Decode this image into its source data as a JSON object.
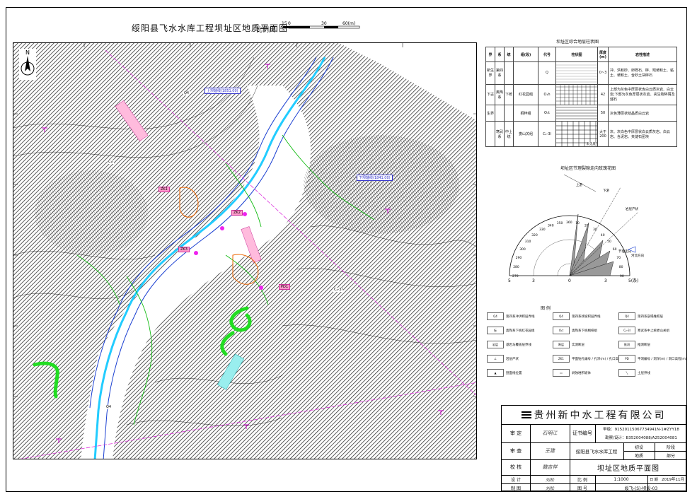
{
  "header": {
    "title": "绥阳县飞水水库工程坝址区地质平面图",
    "scale_label": "比例尺",
    "scale_ticks": [
      "15",
      "0",
      "30",
      "60(m)"
    ]
  },
  "map": {
    "north_label": "N",
    "labels": [
      {
        "text": "上坝轴线(1851.00)",
        "style": "blue"
      },
      {
        "text": "下坝轴线(1841.00)",
        "style": "blue"
      },
      {
        "text": "Q4",
        "style": "dark"
      },
      {
        "text": "C₂l",
        "style": "dark"
      },
      {
        "text": "ZK1",
        "style": "pink"
      },
      {
        "text": "ZK2",
        "style": "pink"
      },
      {
        "text": "ZK3",
        "style": "pink"
      },
      {
        "text": "PD1",
        "style": "pink"
      },
      {
        "text": "C₂-3l",
        "style": "dark"
      },
      {
        "text": "Q4",
        "style": "dark"
      }
    ]
  },
  "stratigraphy": {
    "title": "坝址区综合地层柱状图",
    "headers": [
      "界",
      "系",
      "统",
      "组(段)",
      "代号",
      "柱状图",
      "厚度(m)",
      "岩性描述"
    ],
    "rows": [
      [
        "新生界",
        "第四系",
        "",
        "",
        "Q",
        "",
        "0~3",
        "冲、洪积砂、卵砾石、碎、残坡积土、粘土、坡积土、含砂土块碎石"
      ],
      [
        "下古",
        "奥陶系",
        "下统",
        "红花园组",
        "O₁h",
        "",
        "42",
        "上部为灰色中厚层状含白云质灰岩、白云岩;下部为灰色厚层状灰岩、夹生物碎屑及燧石"
      ],
      [
        "生界",
        "",
        "",
        "桐梓组",
        "O₁t",
        "",
        "50",
        "灰色薄层状结晶质白云岩"
      ],
      [
        "",
        "寒武系",
        "中上统",
        "娄山关组",
        "C₂-3l",
        "",
        "大于200",
        "灰、灰白色中厚层状白云质灰岩、白云岩、含泥岩、夹燧石团块"
      ]
    ],
    "bottom_note": "未见底"
  },
  "rose": {
    "title": "坝址区节理裂隙走向玫瑰花图",
    "axis_labels": [
      "5",
      "3",
      "0",
      "3",
      "5(条)"
    ],
    "angle_labels": [
      "360",
      "350",
      "340",
      "330",
      "320",
      "310",
      "300",
      "290",
      "280",
      "270",
      "10",
      "20",
      "30",
      "40",
      "50",
      "60",
      "70",
      "80",
      "90"
    ],
    "annotations": [
      "上游",
      "下游",
      "岩层产状",
      "节理走向",
      "河流方向"
    ]
  },
  "legend": {
    "title": "图    例",
    "items": [
      {
        "symbol": "Q4",
        "label": "第四系冲洪积层界线"
      },
      {
        "symbol": "Q4",
        "label": "第四系残坡积层界线"
      },
      {
        "symbol": "Q4",
        "label": "第四系崩塌堆积层"
      },
      {
        "symbol": "标",
        "label": "奥陶系下统红花园组"
      },
      {
        "symbol": "O₁t",
        "label": "奥陶系下统桐梓组"
      },
      {
        "symbol": "C₂-3l",
        "label": "寒武系中上统娄山关组"
      },
      {
        "symbol": "岩层",
        "label": "基岩与覆盖层界线"
      },
      {
        "symbol": "断层",
        "label": "实测断层"
      },
      {
        "symbol": "推测",
        "label": "推测断层"
      },
      {
        "symbol": "∠",
        "label": "岩层产状"
      },
      {
        "symbol": "ZK1",
        "label": "平面钻孔编号 / 孔深(m) / 孔口高程(m)"
      },
      {
        "symbol": "PD",
        "label": "平洞编号 / 洞深(m) / 洞口高程(m)"
      },
      {
        "symbol": "▲",
        "label": "剖面线位置"
      },
      {
        "symbol": "▭",
        "label": "剥蚀堆积坡体"
      },
      {
        "symbol": "╲",
        "label": "土层界线"
      }
    ]
  },
  "title_block": {
    "company": "贵州新中水工程有限公司",
    "cert_label": "证书编号",
    "cert_lines": [
      "甲级：91520115067734941N-1#ZYY18",
      "勘察/设计：B352004088/A252004081"
    ],
    "rows": [
      {
        "role": "审  定",
        "name": "石明江"
      },
      {
        "role": "审  查",
        "name": "王建"
      },
      {
        "role": "校  核",
        "name": "魏吉祥"
      },
      {
        "role": "设  计",
        "name": "刘松"
      },
      {
        "role": "制  图",
        "name": "刘松"
      }
    ],
    "project": "绥阳县飞水水库工程",
    "stage_labels": [
      "初设",
      "阶段"
    ],
    "sub_labels": [
      "地质",
      "部分"
    ],
    "drawing_title": "坝址区地质平面图",
    "scale_label": "比  例",
    "scale_value": "1:1000",
    "date_label": "日  期",
    "date_value": "2019年11月",
    "drawing_no_label": "图  号",
    "drawing_no_value": "绥飞-(S)-坝设-03"
  }
}
